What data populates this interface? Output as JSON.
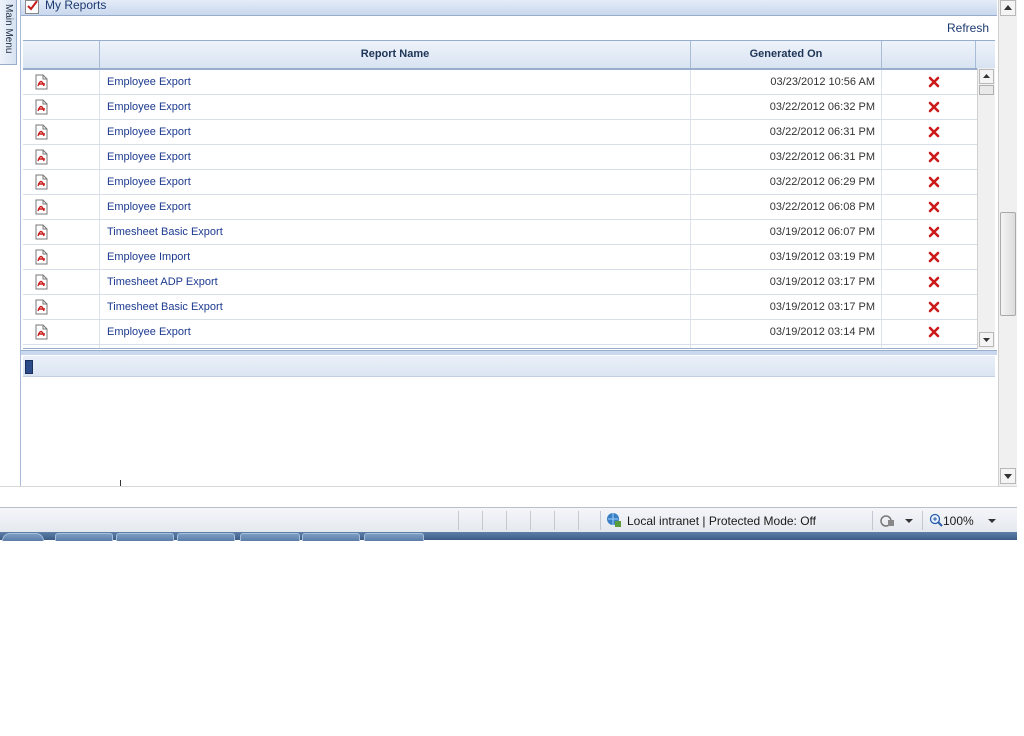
{
  "side_tab": {
    "label": "Main Menu"
  },
  "panel": {
    "title": "My Reports",
    "refresh_label": "Refresh"
  },
  "grid": {
    "columns": [
      "",
      "Report Name",
      "Generated On",
      ""
    ],
    "rows": [
      {
        "name": "Employee Export",
        "generated": "03/23/2012 10:56 AM"
      },
      {
        "name": "Employee Export",
        "generated": "03/22/2012 06:32 PM"
      },
      {
        "name": "Employee Export",
        "generated": "03/22/2012 06:31 PM"
      },
      {
        "name": "Employee Export",
        "generated": "03/22/2012 06:31 PM"
      },
      {
        "name": "Employee Export",
        "generated": "03/22/2012 06:29 PM"
      },
      {
        "name": "Employee Export",
        "generated": "03/22/2012 06:08 PM"
      },
      {
        "name": "Timesheet Basic Export",
        "generated": "03/19/2012 06:07 PM"
      },
      {
        "name": "Employee Import",
        "generated": "03/19/2012 03:19 PM"
      },
      {
        "name": "Timesheet ADP Export",
        "generated": "03/19/2012 03:17 PM"
      },
      {
        "name": "Timesheet Basic Export",
        "generated": "03/19/2012 03:17 PM"
      },
      {
        "name": "Employee Export",
        "generated": "03/19/2012 03:14 PM"
      },
      {
        "name": "",
        "generated": ""
      }
    ],
    "row_icon": "pdf-icon",
    "action_icon": "delete-icon"
  },
  "statusbar": {
    "zone": "Local intranet | Protected Mode: Off",
    "zoom": "100%"
  },
  "colors": {
    "link": "#1c3a90",
    "delete": "#cc1a1a",
    "header_bg": "#d8e3f2"
  }
}
